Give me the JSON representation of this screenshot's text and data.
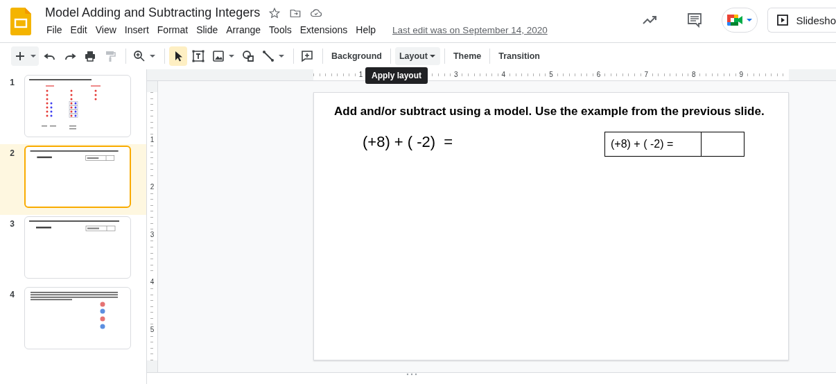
{
  "document": {
    "title": "Model Adding and Subtracting Integers",
    "menu": [
      "File",
      "Edit",
      "View",
      "Insert",
      "Format",
      "Slide",
      "Arrange",
      "Tools",
      "Extensions",
      "Help"
    ],
    "last_edit": "Last edit was on September 14, 2020"
  },
  "header_actions": {
    "slideshow": "Slidesho"
  },
  "toolbar": {
    "tools": [
      {
        "selected": false,
        "disabled": false
      },
      {
        "selected": false,
        "disabled": false
      },
      {
        "selected": false,
        "disabled": false
      },
      {
        "selected": false,
        "disabled": false
      },
      {
        "selected": false,
        "disabled": true
      },
      {
        "selected": false,
        "disabled": false
      },
      {
        "selected": true,
        "disabled": false
      },
      {
        "selected": false,
        "disabled": false
      },
      {
        "selected": false,
        "disabled": false
      },
      {
        "selected": false,
        "disabled": false
      },
      {
        "selected": false,
        "disabled": false
      },
      {
        "selected": false,
        "disabled": false
      }
    ],
    "buttons": [
      {
        "label": "Background",
        "menu": false,
        "hovered": false
      },
      {
        "label": "Layout",
        "menu": true,
        "hovered": true
      },
      {
        "label": "Theme",
        "menu": false,
        "hovered": false
      },
      {
        "label": "Transition",
        "menu": false,
        "hovered": false
      }
    ],
    "tooltip": "Apply layout"
  },
  "slides": [
    {
      "number": "1",
      "kind": "dots_example",
      "selected": false
    },
    {
      "number": "2",
      "kind": "equation",
      "selected": true
    },
    {
      "number": "3",
      "kind": "equation",
      "selected": false
    },
    {
      "number": "4",
      "kind": "word_problem",
      "selected": false
    }
  ],
  "ruler": {
    "horizontal": [
      "1",
      "3",
      "4",
      "5",
      "6",
      "7",
      "8",
      "9"
    ],
    "vertical": [
      "1",
      "2",
      "3",
      "4",
      "5"
    ]
  },
  "slide": {
    "title": "Add and/or subtract using a model. Use the example from the previous slide.",
    "expression": "(+8) + ( -2)  =",
    "table": {
      "cells": [
        "(+8) + ( -2) ="
      ]
    }
  }
}
